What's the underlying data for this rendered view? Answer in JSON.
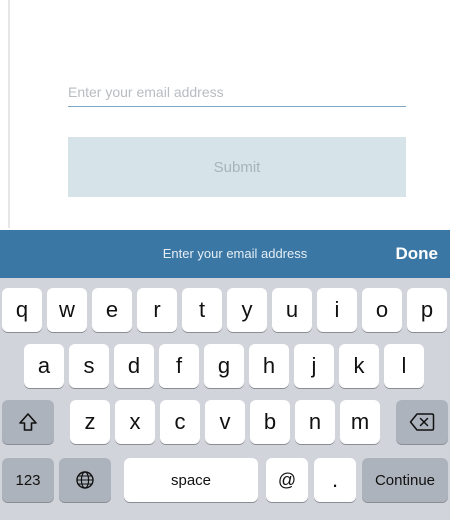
{
  "form": {
    "email_placeholder": "Enter your email address",
    "email_value": "",
    "submit_label": "Submit"
  },
  "toolbar": {
    "title": "Enter your email address",
    "done_label": "Done"
  },
  "keyboard": {
    "row1": [
      "q",
      "w",
      "e",
      "r",
      "t",
      "y",
      "u",
      "i",
      "o",
      "p"
    ],
    "row2": [
      "a",
      "s",
      "d",
      "f",
      "g",
      "h",
      "j",
      "k",
      "l"
    ],
    "row3": [
      "z",
      "x",
      "c",
      "v",
      "b",
      "n",
      "m"
    ],
    "numbers_label": "123",
    "space_label": "space",
    "at_label": "@",
    "dot_label": ".",
    "continue_label": "Continue",
    "icons": {
      "shift": "shift-icon",
      "backspace": "backspace-icon",
      "globe": "globe-icon"
    }
  },
  "colors": {
    "toolbar": "#3b77a4",
    "submit_disabled": "#d6e3e8",
    "keyboard_bg": "#d1d4da"
  }
}
